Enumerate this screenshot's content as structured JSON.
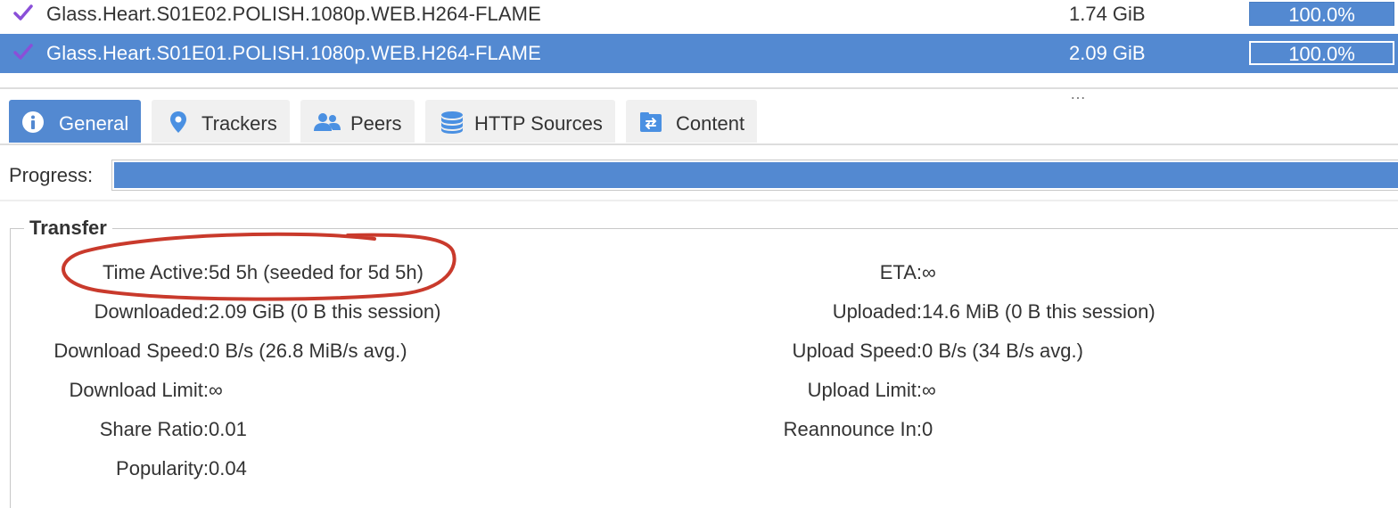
{
  "torrents": [
    {
      "name": "Glass.Heart.S01E02.POLISH.1080p.WEB.H264-FLAME",
      "size": "1.74 GiB",
      "progress": "100.0%",
      "selected": false
    },
    {
      "name": "Glass.Heart.S01E01.POLISH.1080p.WEB.H264-FLAME",
      "size": "2.09 GiB",
      "progress": "100.0%",
      "selected": true
    }
  ],
  "splitter_grip": "…",
  "tabs": [
    {
      "label": "General",
      "icon": "info-icon",
      "active": true
    },
    {
      "label": "Trackers",
      "icon": "location-pin-icon",
      "active": false
    },
    {
      "label": "Peers",
      "icon": "users-icon",
      "active": false
    },
    {
      "label": "HTTP Sources",
      "icon": "database-icon",
      "active": false
    },
    {
      "label": "Content",
      "icon": "content-icon",
      "active": false
    }
  ],
  "progress": {
    "label": "Progress:",
    "fraction": 1.0
  },
  "transfer": {
    "legend": "Transfer",
    "left": [
      {
        "key": "Time Active:",
        "value": "5d 5h (seeded for 5d 5h)"
      },
      {
        "key": "Downloaded:",
        "value": "2.09 GiB (0 B this session)"
      },
      {
        "key": "Download Speed:",
        "value": "0 B/s (26.8 MiB/s avg.)"
      },
      {
        "key": "Download Limit:",
        "value": "∞"
      },
      {
        "key": "Share Ratio:",
        "value": "0.01"
      },
      {
        "key": "Popularity:",
        "value": "0.04"
      }
    ],
    "right": [
      {
        "key": "ETA:",
        "value": "∞"
      },
      {
        "key": "Uploaded:",
        "value": "14.6 MiB (0 B this session)"
      },
      {
        "key": "Upload Speed:",
        "value": "0 B/s (34 B/s avg.)"
      },
      {
        "key": "Upload Limit:",
        "value": "∞"
      },
      {
        "key": "Reannounce In:",
        "value": "0"
      }
    ]
  },
  "colors": {
    "accent": "#5389d1",
    "check": "#8a4fd8",
    "annotation": "#c93a2c"
  },
  "annotation": {
    "shape": "hand-drawn-ellipse",
    "target": "time-active-row"
  }
}
